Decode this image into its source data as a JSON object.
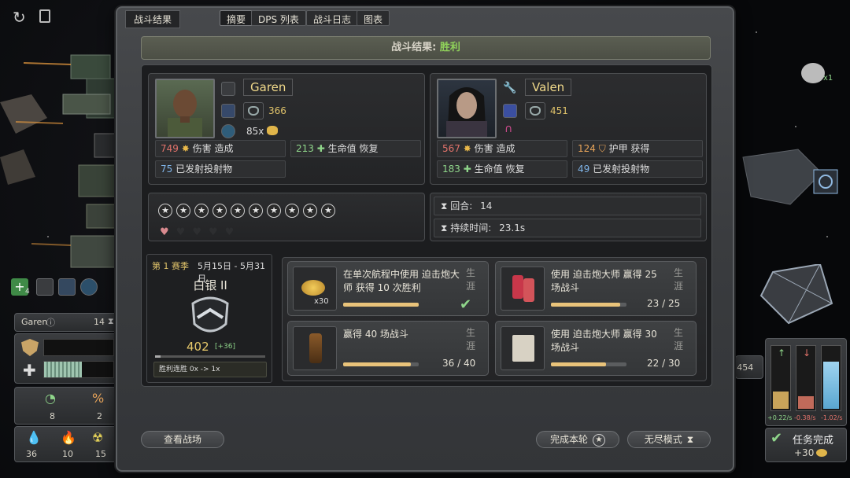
{
  "dialog": {
    "title": "战斗结果",
    "tabs": [
      {
        "label": "摘要",
        "active": true
      },
      {
        "label": "DPS 列表",
        "active": false
      },
      {
        "label": "战斗日志",
        "active": false
      },
      {
        "label": "图表",
        "active": false
      }
    ],
    "banner_prefix": "战斗结果:",
    "banner_result": "胜利"
  },
  "pilots": [
    {
      "name": "Garen",
      "armor_value": "366",
      "multiplier": "85x",
      "damage": "749",
      "damage_label": "伤害",
      "damage_verb": "造成",
      "heal": "213",
      "heal_label": "生命值",
      "heal_verb": "恢复",
      "projectiles": "75",
      "projectiles_label": "已发射投射物"
    },
    {
      "name": "Valen",
      "armor_value": "451",
      "damage": "567",
      "damage_label": "伤害",
      "damage_verb": "造成",
      "armor": "124",
      "armor_label": "护甲",
      "armor_verb": "获得",
      "heal": "183",
      "heal_label": "生命值",
      "heal_verb": "恢复",
      "projectiles": "49",
      "projectiles_label": "已发射投射物"
    }
  ],
  "rating": {
    "stars": 10,
    "hearts_total": 5,
    "hearts_filled": 1
  },
  "battle_info": {
    "round_label": "回合:",
    "round_value": "14",
    "duration_label": "持续时间:",
    "duration_value": "23.1s"
  },
  "season": {
    "name": "第 1 赛季",
    "dates": "5月15日 - 5月31日",
    "rank": "白银 II",
    "points": "402",
    "points_delta": "[+36]",
    "win_streak": "胜利连胜 0x -> 1x"
  },
  "quests": [
    {
      "text": "在单次航程中使用 迫击炮大师 获得 10 次胜利",
      "tag": "生涯",
      "icon": "gold-coins-icon",
      "icon_count": "x30",
      "completed": true,
      "progress": 1.0
    },
    {
      "text": "使用 迫击炮大师 赢得 25 场战斗",
      "tag": "生涯",
      "icon": "shells-icon",
      "progress_text": "23 / 25",
      "progress": 0.92
    },
    {
      "text": "赢得 40 场战斗",
      "tag": "生涯",
      "icon": "lantern-icon",
      "progress_text": "36 / 40",
      "progress": 0.9
    },
    {
      "text": "使用 迫击炮大师 赢得 30 场战斗",
      "tag": "生涯",
      "icon": "book-icon",
      "progress_text": "22 / 30",
      "progress": 0.73
    }
  ],
  "footer": {
    "view_battlefield": "查看战场",
    "finish_round": "完成本轮",
    "endless_mode": "无尽模式"
  },
  "left_hud": {
    "pilot": "Garen",
    "level": "14",
    "stat1": "8",
    "stat2": "2",
    "stat3": "36",
    "stat4": "10",
    "stat5": "15",
    "plus_badge": "4"
  },
  "right_hud": {
    "hp_suffix": "/ 454",
    "rate1": "+0.22/s",
    "rate2": "-0.38/s",
    "rate3": "-1.02/s",
    "mission_complete": "任务完成",
    "reward": "+30",
    "drop_count": "x1"
  }
}
